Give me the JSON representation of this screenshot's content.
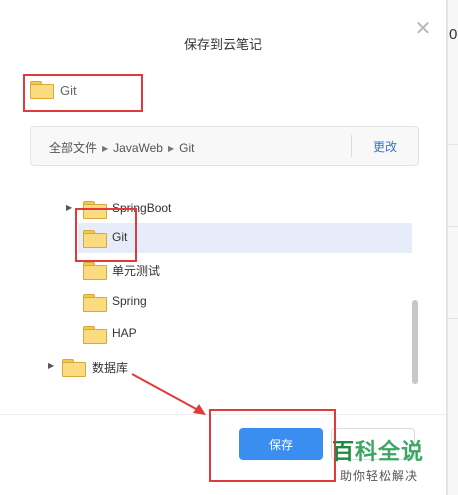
{
  "backdrop": {
    "edge_char": "0"
  },
  "dialog": {
    "title": "保存到云笔记",
    "close_glyph": "✕",
    "selected_folder": "Git",
    "breadcrumb": [
      "全部文件",
      "JavaWeb",
      "Git"
    ],
    "breadcrumb_separator": "▶",
    "change_label": "更改",
    "tree": [
      {
        "label": "SpringBoot",
        "expand": "▶",
        "expandable": true
      },
      {
        "label": "Git",
        "expand": "",
        "expandable": false,
        "selected": true
      },
      {
        "label": "单元测试",
        "expand": "",
        "expandable": false
      },
      {
        "label": "Spring",
        "expand": "",
        "expandable": false
      },
      {
        "label": "HAP",
        "expand": "",
        "expandable": false
      },
      {
        "label": "数据库",
        "expand": "▶",
        "expandable": true
      }
    ],
    "save_label": "保存",
    "cancel_label": ""
  },
  "watermark": {
    "brand_first": "百",
    "brand_rest": "科全说",
    "slogan": "助你轻松解决"
  },
  "colors": {
    "primary": "#3a8ef0",
    "highlight": "#e13a3a",
    "folder": "#fbdb7f",
    "selected_row": "#e6ecf9",
    "watermark": "#3ea564"
  }
}
